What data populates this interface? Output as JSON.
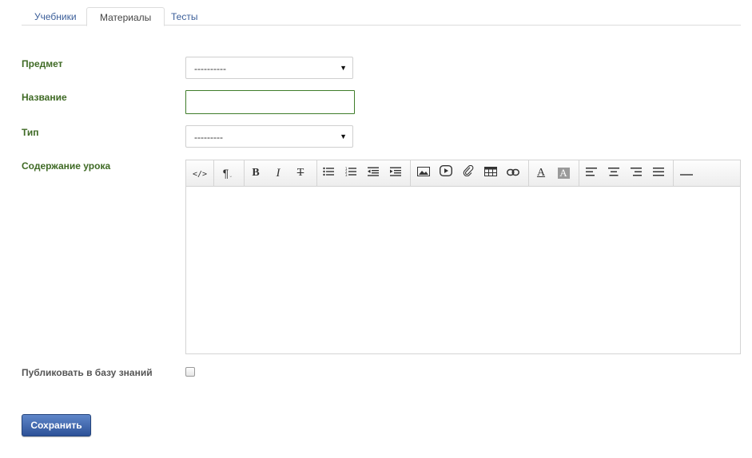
{
  "tabs": [
    {
      "label": "Учебники",
      "active": false
    },
    {
      "label": "Материалы",
      "active": true
    },
    {
      "label": "Тесты",
      "active": false
    }
  ],
  "form": {
    "subject_label": "Предмет",
    "subject_value": "----------",
    "title_label": "Название",
    "title_value": "",
    "type_label": "Тип",
    "type_value": "---------",
    "content_label": "Содержание урока",
    "publish_label": "Публиковать в базу знаний",
    "publish_checked": false
  },
  "editor": {
    "toolbar": [
      {
        "name": "html-code-icon",
        "glyph": "</>"
      },
      {
        "name": "paragraph-format-icon",
        "glyph": "¶"
      },
      {
        "name": "bold-icon",
        "glyph": "B"
      },
      {
        "name": "italic-icon",
        "glyph": "I"
      },
      {
        "name": "strikethrough-icon",
        "glyph": "T"
      },
      {
        "name": "unordered-list-icon",
        "glyph": ""
      },
      {
        "name": "ordered-list-icon",
        "glyph": ""
      },
      {
        "name": "outdent-icon",
        "glyph": ""
      },
      {
        "name": "indent-icon",
        "glyph": ""
      },
      {
        "name": "image-icon",
        "glyph": ""
      },
      {
        "name": "video-icon",
        "glyph": ""
      },
      {
        "name": "attachment-icon",
        "glyph": ""
      },
      {
        "name": "table-icon",
        "glyph": ""
      },
      {
        "name": "link-icon",
        "glyph": ""
      },
      {
        "name": "font-color-icon",
        "glyph": "A"
      },
      {
        "name": "background-color-icon",
        "glyph": "A"
      },
      {
        "name": "align-left-icon",
        "glyph": ""
      },
      {
        "name": "align-center-icon",
        "glyph": ""
      },
      {
        "name": "align-right-icon",
        "glyph": ""
      },
      {
        "name": "align-justify-icon",
        "glyph": ""
      },
      {
        "name": "horizontal-rule-icon",
        "glyph": ""
      }
    ]
  },
  "actions": {
    "save_label": "Сохранить"
  },
  "colors": {
    "label_green": "#3f6a25",
    "tab_link": "#3b5e99",
    "button_blue": "#3a5fa6"
  }
}
